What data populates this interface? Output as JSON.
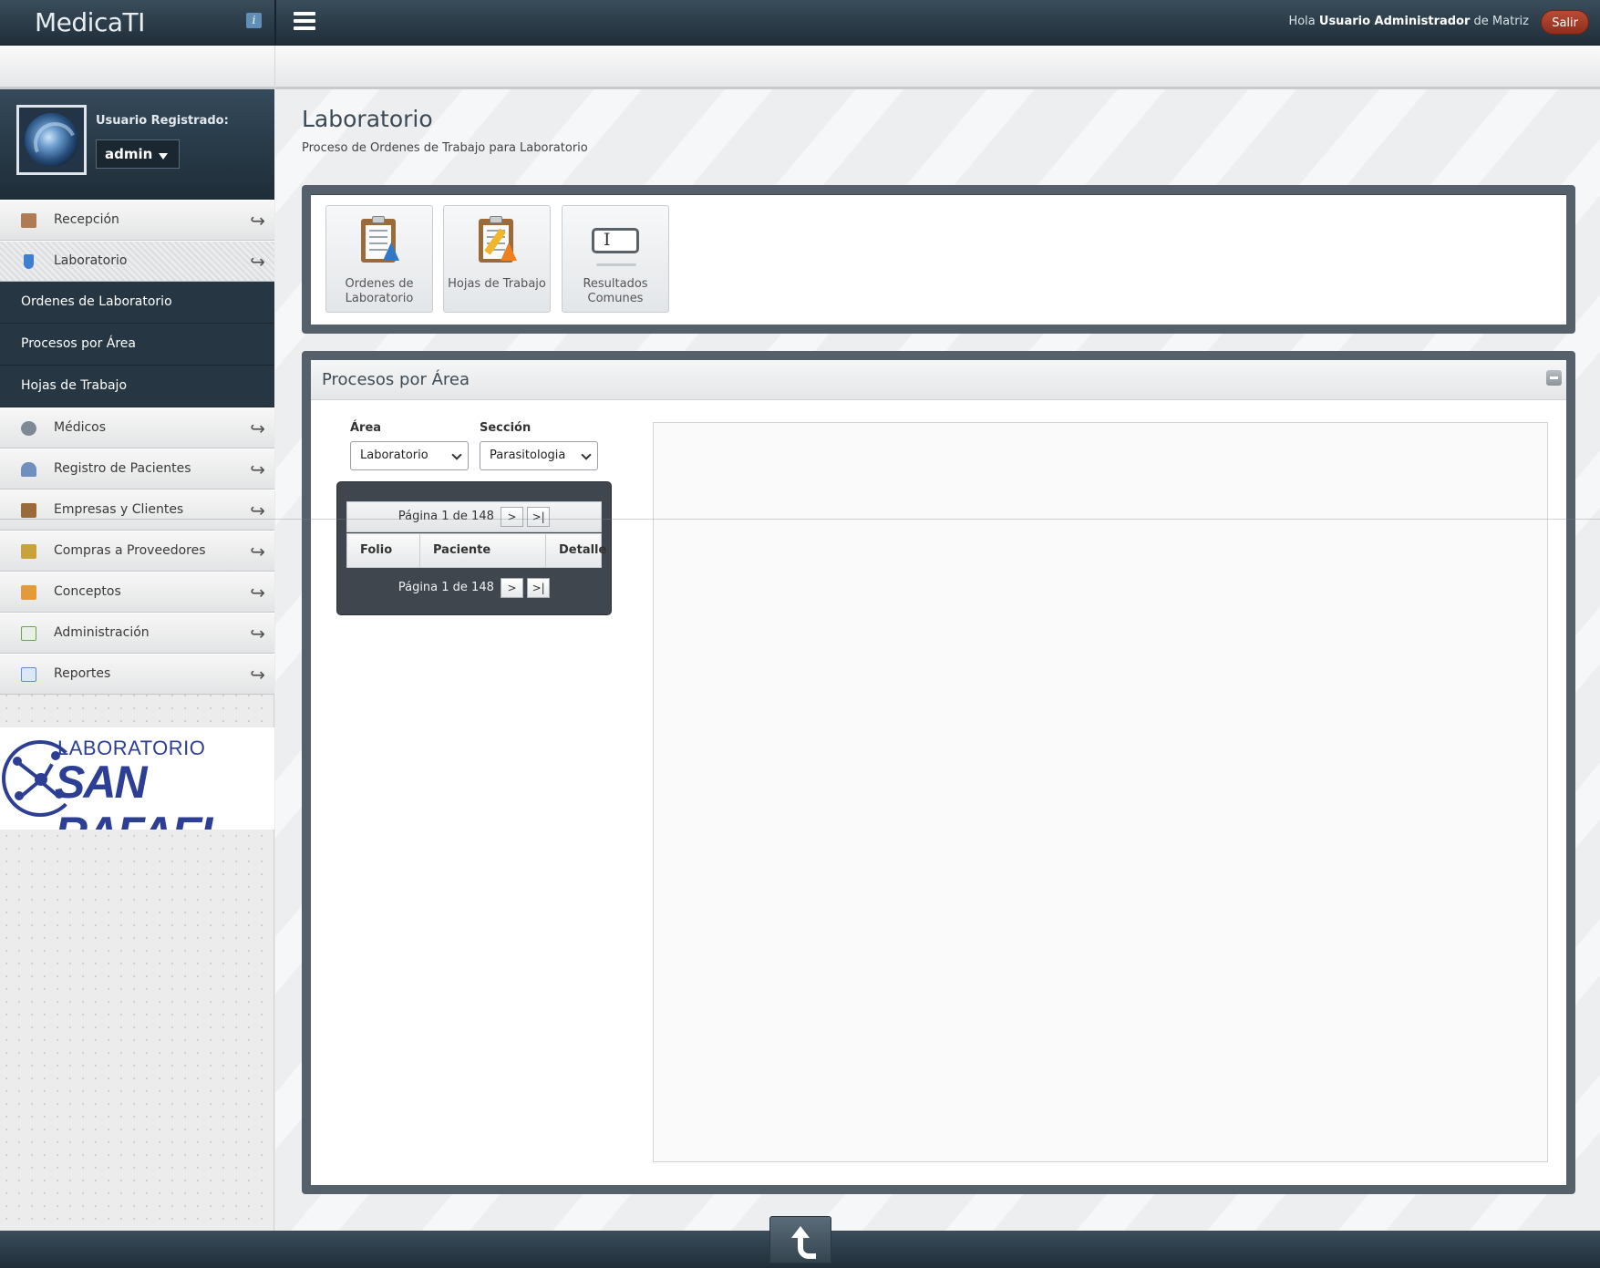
{
  "app": {
    "brand": "MedicaTI",
    "info_badge": "i",
    "greeting_prefix": "Hola",
    "user_display_name": "Usuario Administrador",
    "greeting_suffix": "de Matriz",
    "logout_label": "Salir"
  },
  "user": {
    "label": "Usuario Registrado:",
    "username": "admin"
  },
  "sidebar": {
    "items": [
      {
        "label": "Recepción",
        "icon": "reception-icon",
        "color": "#b07a52"
      },
      {
        "label": "Laboratorio",
        "icon": "flask-icon",
        "color": "#3f7fcf",
        "active": true
      },
      {
        "label": "Ordenes de Laboratorio",
        "submenu": true
      },
      {
        "label": "Procesos por Área",
        "submenu": true
      },
      {
        "label": "Hojas de Trabajo",
        "submenu": true
      },
      {
        "label": "Médicos",
        "icon": "stethoscope-icon",
        "color": "#7d8a96"
      },
      {
        "label": "Registro de Pacientes",
        "icon": "patient-icon",
        "color": "#6f8fbf"
      },
      {
        "label": "Empresas y Clientes",
        "icon": "building-icon",
        "color": "#9b6a3a"
      },
      {
        "label": "Compras a Proveedores",
        "icon": "purchase-icon",
        "color": "#c8a23c"
      },
      {
        "label": "Conceptos",
        "icon": "box-icon",
        "color": "#e39b3a"
      },
      {
        "label": "Administración",
        "icon": "admin-list-icon",
        "color": "#6aa34f"
      },
      {
        "label": "Reportes",
        "icon": "report-icon",
        "color": "#5a8fd0"
      }
    ],
    "logo": {
      "top_text": "LABORATORIO",
      "main_text": "SAN RAFAEL",
      "color": "#2c3f94"
    }
  },
  "page": {
    "title": "Laboratorio",
    "subtitle": "Proceso de Ordenes de Trabajo para Laboratorio"
  },
  "shortcuts": [
    {
      "label": "Ordenes de Laboratorio",
      "icon": "lab-orders-icon"
    },
    {
      "label": "Hojas de Trabajo",
      "icon": "worksheets-icon"
    },
    {
      "label": "Resultados Comunes",
      "icon": "text-field-icon"
    }
  ],
  "process": {
    "title": "Procesos por Área",
    "area_label": "Área",
    "area_value": "Laboratorio",
    "section_label": "Sección",
    "section_value": "Parasitologia",
    "pager_text": "Página 1 de 148",
    "next_label": ">",
    "last_label": ">|",
    "columns": [
      "Folio",
      "Paciente",
      "Detalle"
    ]
  },
  "colors": {
    "topbar": "#1f2e39",
    "logout": "#a63c28",
    "panel_border": "#56606a",
    "submenu": "#263642"
  }
}
